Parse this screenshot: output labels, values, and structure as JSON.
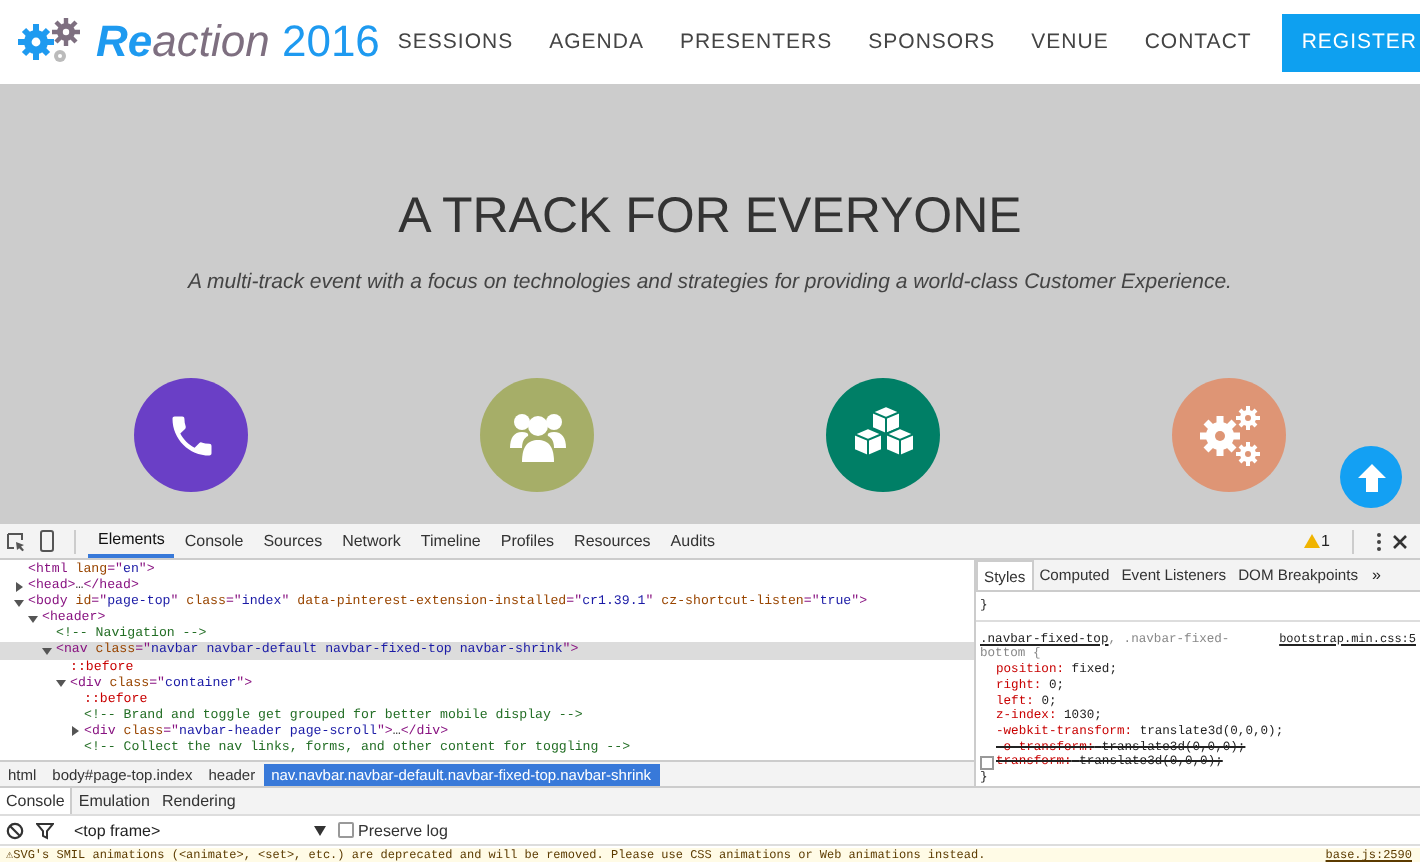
{
  "site_nav": {
    "logo": {
      "first": "Re",
      "rest": "action",
      "year": "2016"
    },
    "links": [
      {
        "label": "SESSIONS"
      },
      {
        "label": "AGENDA"
      },
      {
        "label": "PRESENTERS"
      },
      {
        "label": "SPONSORS"
      },
      {
        "label": "VENUE"
      },
      {
        "label": "CONTACT"
      }
    ],
    "cta": "REGISTER"
  },
  "hero": {
    "title": "A TRACK FOR EVERYONE",
    "subtitle": "A multi-track event with a focus on technologies and strategies for providing a world-class Customer Experience.",
    "features": [
      {
        "kind": "phone",
        "color": "#6a3fc6"
      },
      {
        "kind": "people",
        "color": "#a6ae68"
      },
      {
        "kind": "cubes",
        "color": "#007f66"
      },
      {
        "kind": "gears",
        "color": "#de9575"
      }
    ]
  },
  "devtools": {
    "tabs": [
      {
        "label": "Elements",
        "selected": true
      },
      {
        "label": "Console",
        "selected": false
      },
      {
        "label": "Sources",
        "selected": false
      },
      {
        "label": "Network",
        "selected": false
      },
      {
        "label": "Timeline",
        "selected": false
      },
      {
        "label": "Profiles",
        "selected": false
      },
      {
        "label": "Resources",
        "selected": false
      },
      {
        "label": "Audits",
        "selected": false
      }
    ],
    "warning_count": "1",
    "dom_tree": [
      {
        "segments": [
          {
            "kind": "tag",
            "text": "<html "
          },
          {
            "kind": "attr",
            "text": "lang"
          },
          {
            "kind": "tag",
            "text": "=\""
          },
          {
            "kind": "val",
            "text": "en"
          },
          {
            "kind": "tag",
            "text": "\">"
          }
        ],
        "selected": false
      },
      {
        "expanded": false,
        "segments": [
          {
            "kind": "tag",
            "text": "<head>"
          },
          {
            "kind": "plain",
            "text": "…"
          },
          {
            "kind": "tag",
            "text": "</head>"
          }
        ],
        "selected": false
      },
      {
        "expanded": true,
        "segments": [
          {
            "kind": "tag",
            "text": "<body "
          },
          {
            "kind": "attr",
            "text": "id"
          },
          {
            "kind": "tag",
            "text": "=\""
          },
          {
            "kind": "val",
            "text": "page-top"
          },
          {
            "kind": "tag",
            "text": "\" "
          },
          {
            "kind": "attr",
            "text": "class"
          },
          {
            "kind": "tag",
            "text": "=\""
          },
          {
            "kind": "val",
            "text": "index"
          },
          {
            "kind": "tag",
            "text": "\" "
          },
          {
            "kind": "attr",
            "text": "data-pinterest-extension-installed"
          },
          {
            "kind": "tag",
            "text": "=\""
          },
          {
            "kind": "val",
            "text": "cr1.39.1"
          },
          {
            "kind": "tag",
            "text": "\" "
          },
          {
            "kind": "attr",
            "text": "cz-shortcut-listen"
          },
          {
            "kind": "tag",
            "text": "=\""
          },
          {
            "kind": "val",
            "text": "true"
          },
          {
            "kind": "tag",
            "text": "\">"
          }
        ],
        "selected": false,
        "children": [
          {
            "expanded": true,
            "segments": [
              {
                "kind": "tag",
                "text": "<header>"
              }
            ],
            "selected": false,
            "children": [
              {
                "segments": [
                  {
                    "kind": "comment",
                    "text": "<!-- Navigation -->"
                  }
                ],
                "selected": false
              },
              {
                "expanded": true,
                "segments": [
                  {
                    "kind": "tag",
                    "text": "<nav "
                  },
                  {
                    "kind": "attr",
                    "text": "class"
                  },
                  {
                    "kind": "tag",
                    "text": "=\""
                  },
                  {
                    "kind": "val",
                    "text": "navbar navbar-default navbar-fixed-top navbar-shrink"
                  },
                  {
                    "kind": "tag",
                    "text": "\">"
                  }
                ],
                "selected": true,
                "children": [
                  {
                    "segments": [
                      {
                        "kind": "pseudo",
                        "text": "::before"
                      }
                    ],
                    "selected": false
                  },
                  {
                    "expanded": true,
                    "segments": [
                      {
                        "kind": "tag",
                        "text": "<div "
                      },
                      {
                        "kind": "attr",
                        "text": "class"
                      },
                      {
                        "kind": "tag",
                        "text": "=\""
                      },
                      {
                        "kind": "val",
                        "text": "container"
                      },
                      {
                        "kind": "tag",
                        "text": "\">"
                      }
                    ],
                    "selected": false,
                    "children": [
                      {
                        "segments": [
                          {
                            "kind": "pseudo",
                            "text": "::before"
                          }
                        ],
                        "selected": false
                      },
                      {
                        "segments": [
                          {
                            "kind": "comment",
                            "text": "<!-- Brand and toggle get grouped for better mobile display -->"
                          }
                        ],
                        "selected": false
                      },
                      {
                        "expanded": false,
                        "segments": [
                          {
                            "kind": "tag",
                            "text": "<div "
                          },
                          {
                            "kind": "attr",
                            "text": "class"
                          },
                          {
                            "kind": "tag",
                            "text": "=\""
                          },
                          {
                            "kind": "val",
                            "text": "navbar-header page-scroll"
                          },
                          {
                            "kind": "tag",
                            "text": "\">"
                          },
                          {
                            "kind": "plain",
                            "text": "…"
                          },
                          {
                            "kind": "tag",
                            "text": "</div>"
                          }
                        ],
                        "selected": false
                      },
                      {
                        "segments": [
                          {
                            "kind": "comment",
                            "text": "<!-- Collect the nav links, forms, and other content for toggling -->"
                          }
                        ],
                        "selected": false
                      }
                    ]
                  }
                ]
              }
            ]
          }
        ]
      }
    ],
    "breadcrumbs": [
      {
        "label": "html",
        "selected": false
      },
      {
        "label": "body#page-top.index",
        "selected": false
      },
      {
        "label": "header",
        "selected": false
      },
      {
        "label": "nav.navbar.navbar-default.navbar-fixed-top.navbar-shrink",
        "selected": true
      }
    ],
    "side_tabs": [
      {
        "label": "Styles",
        "selected": true
      },
      {
        "label": "Computed",
        "selected": false
      },
      {
        "label": "Event Listeners",
        "selected": false
      },
      {
        "label": "DOM Breakpoints",
        "selected": false
      }
    ],
    "side_more": "»",
    "styles": [
      {
        "close": "}"
      },
      {
        "selector": ".navbar-fixed-top",
        "selector_rest": ", .navbar-fixed-",
        "selector_wrap": "bottom {",
        "source": "bootstrap.min.css:5",
        "close": "}",
        "declarations": [
          {
            "name": "position:",
            "value": "fixed;",
            "overridden": false,
            "disabled": false
          },
          {
            "name": "right:",
            "value": "0;",
            "overridden": false,
            "disabled": false
          },
          {
            "name": "left:",
            "value": "0;",
            "overridden": false,
            "disabled": false
          },
          {
            "name": "z-index:",
            "value": "1030;",
            "overridden": false,
            "disabled": false
          },
          {
            "name": "-webkit-transform:",
            "value": "translate3d(0,0,0);",
            "overridden": false,
            "disabled": false
          },
          {
            "name": "-o-transform:",
            "value": "translate3d(0,0,0);",
            "overridden": true,
            "disabled": false
          },
          {
            "name": "transform:",
            "value": "translate3d(0,0,0);",
            "overridden": true,
            "disabled": true
          }
        ]
      }
    ],
    "drawer_tabs": [
      {
        "label": "Console",
        "selected": true
      },
      {
        "label": "Emulation",
        "selected": false
      },
      {
        "label": "Rendering",
        "selected": false
      }
    ],
    "frame_select": "<top frame>",
    "preserve_log": {
      "label": "Preserve log",
      "checked": false
    },
    "messages": [
      {
        "icon": "⚠",
        "text": "SVG's SMIL animations (<animate>, <set>, etc.) are deprecated and will be removed. Please use CSS animations or Web animations instead.",
        "source": "base.js:2590"
      }
    ]
  }
}
